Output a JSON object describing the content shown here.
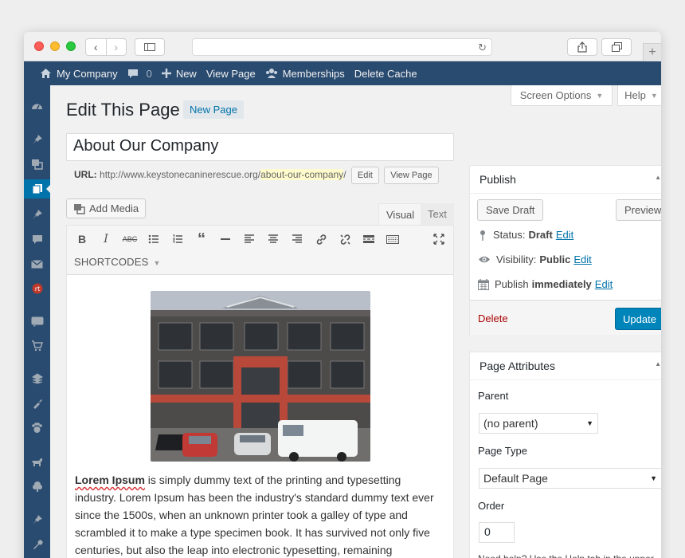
{
  "adminbar": {
    "site_name": "My Company",
    "comments_count": "0",
    "new_label": "New",
    "view_page": "View Page",
    "memberships": "Memberships",
    "delete_cache": "Delete Cache"
  },
  "screen": {
    "screen_options": "Screen Options",
    "help": "Help"
  },
  "page": {
    "title": "Edit This Page",
    "add_new": "New Page",
    "post_title": "About Our Company",
    "url_label": "URL:",
    "url_base": "http://www.keystonecaninerescue.org/",
    "url_slug": "about-our-company",
    "url_trail": "/",
    "edit_btn": "Edit",
    "view_page_btn": "View Page"
  },
  "editor": {
    "add_media": "Add Media",
    "tab_visual": "Visual",
    "tab_text": "Text",
    "shortcodes": "SHORTCODES",
    "body_bold": "Lorem Ipsum",
    "body_text": " is simply dummy text of the printing and typesetting industry. Lorem Ipsum has been the industry's standard dummy text ever since the 1500s, when an unknown printer took a galley of type and scrambled it to make a type specimen book. It has survived not only five centuries, but also the leap into electronic typesetting, remaining"
  },
  "publish": {
    "title": "Publish",
    "save_draft": "Save Draft",
    "preview": "Preview",
    "status_label": "Status:",
    "status_value": "Draft",
    "visibility_label": "Visibility:",
    "visibility_value": "Public",
    "publish_label": "Publish",
    "publish_value": "immediately",
    "edit_link": "Edit",
    "delete": "Delete",
    "update": "Update"
  },
  "attributes": {
    "title": "Page Attributes",
    "parent_label": "Parent",
    "parent_value": "(no parent)",
    "type_label": "Page Type",
    "type_value": "Default Page",
    "order_label": "Order",
    "order_value": "0",
    "help": "Need help? Use the Help tab in the upper right of your screen."
  },
  "colors": {
    "adminbar": "#2a4b70",
    "accent": "#0073aa",
    "update": "#0085ba"
  }
}
